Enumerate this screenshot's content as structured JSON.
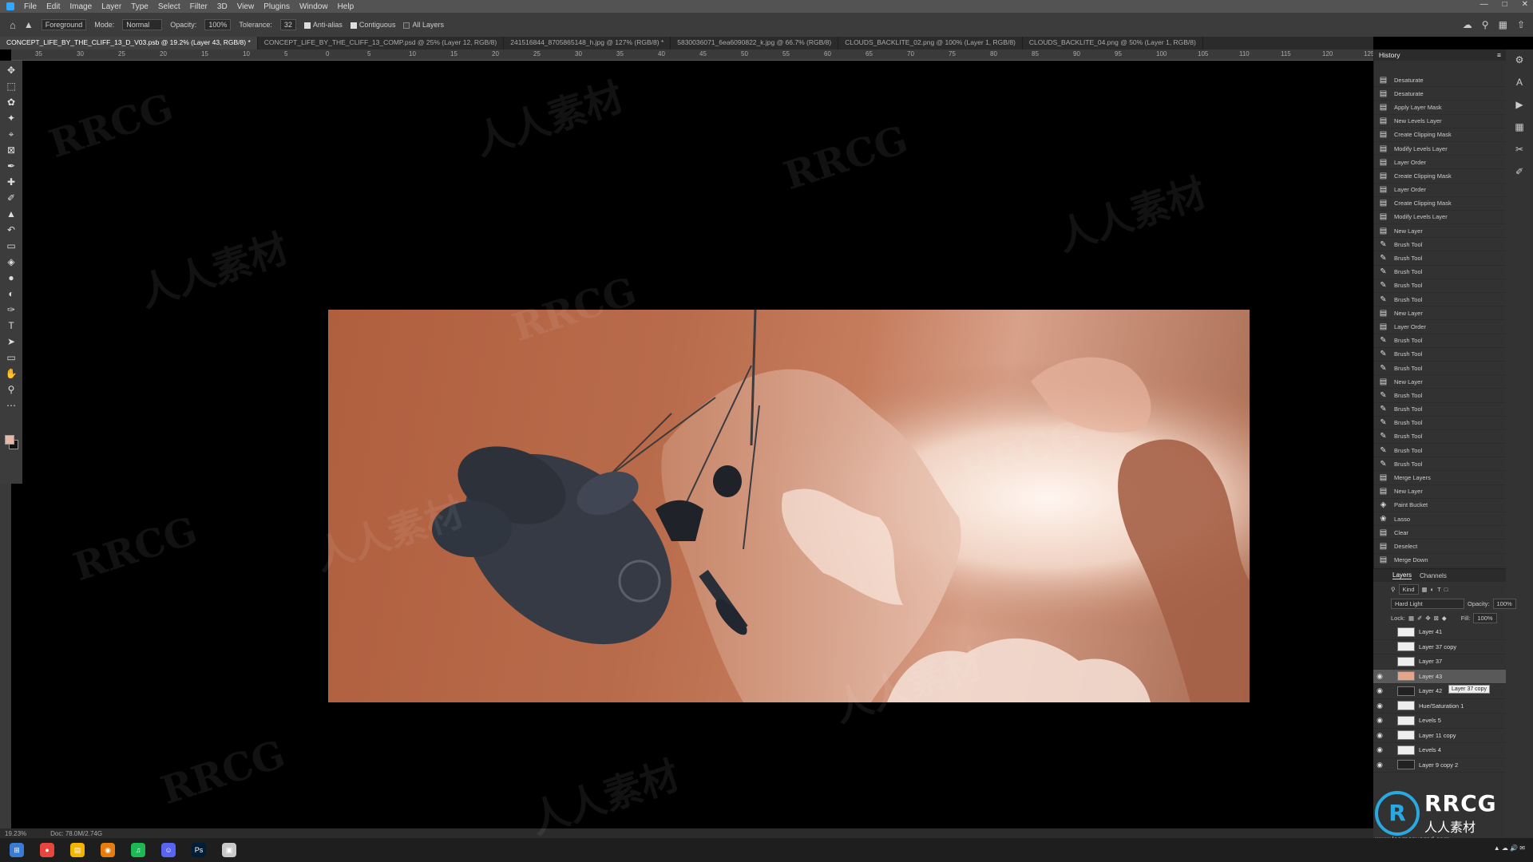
{
  "menubar": {
    "items": [
      "File",
      "Edit",
      "Image",
      "Layer",
      "Type",
      "Select",
      "Filter",
      "3D",
      "View",
      "Plugins",
      "Window",
      "Help"
    ]
  },
  "options": {
    "foreground": "Foreground",
    "mode_label": "Mode:",
    "mode_value": "Normal",
    "opacity_label": "Opacity:",
    "opacity_value": "100%",
    "tolerance_label": "Tolerance:",
    "tolerance_value": "32",
    "anti_alias": "Anti-alias",
    "contiguous": "Contiguous",
    "all_layers": "All Layers"
  },
  "tabs": [
    "CONCEPT_LIFE_BY_THE_CLIFF_13_D_V03.psb @ 19.2% (Layer 43, RGB/8) *",
    "CONCEPT_LIFE_BY_THE_CLIFF_13_COMP.psd @ 25% (Layer 12, RGB/8)",
    "241516844_8705865148_h.jpg @ 127% (RGB/8) *",
    "5830036071_6ea6090822_k.jpg @ 66.7% (RGB/8)",
    "CLOUDS_BACKLITE_02.png @ 100% (Layer 1, RGB/8)",
    "CLOUDS_BACKLITE_04.png @ 50% (Layer 1, RGB/8)"
  ],
  "ruler_ticks": [
    "35",
    "30",
    "25",
    "20",
    "15",
    "10",
    "5",
    "0",
    "5",
    "10",
    "15",
    "20",
    "25",
    "30",
    "35",
    "40",
    "45",
    "50",
    "55",
    "60",
    "65",
    "70",
    "75",
    "80",
    "85",
    "90",
    "95",
    "100",
    "105",
    "110",
    "115",
    "120",
    "125"
  ],
  "status": {
    "zoom": "19.23%",
    "doc": "Doc: 78.0M/2.74G"
  },
  "history": {
    "title": "History",
    "items": [
      "Desaturate",
      "Desaturate",
      "Apply Layer Mask",
      "New Levels Layer",
      "Create Clipping Mask",
      "Modify Levels Layer",
      "Layer Order",
      "Create Clipping Mask",
      "Layer Order",
      "Create Clipping Mask",
      "Modify Levels Layer",
      "New Layer",
      "Brush Tool",
      "Brush Tool",
      "Brush Tool",
      "Brush Tool",
      "Brush Tool",
      "New Layer",
      "Layer Order",
      "Brush Tool",
      "Brush Tool",
      "Brush Tool",
      "New Layer",
      "Brush Tool",
      "Brush Tool",
      "Brush Tool",
      "Brush Tool",
      "Brush Tool",
      "Brush Tool",
      "Merge Layers",
      "New Layer",
      "Paint Bucket",
      "Lasso",
      "Clear",
      "Deselect",
      "Merge Down"
    ],
    "icons": [
      "doc",
      "doc",
      "doc",
      "doc",
      "doc",
      "doc",
      "doc",
      "doc",
      "doc",
      "doc",
      "doc",
      "doc",
      "brush",
      "brush",
      "brush",
      "brush",
      "brush",
      "doc",
      "doc",
      "brush",
      "brush",
      "brush",
      "doc",
      "brush",
      "brush",
      "brush",
      "brush",
      "brush",
      "brush",
      "doc",
      "doc",
      "bucket",
      "lasso",
      "doc",
      "doc",
      "doc"
    ]
  },
  "layers": {
    "tab_layers": "Layers",
    "tab_channels": "Channels",
    "kind": "Kind",
    "blend": "Hard Light",
    "opacity_label": "Opacity:",
    "opacity_value": "100%",
    "lock_label": "Lock:",
    "fill_label": "Fill:",
    "fill_value": "100%",
    "items": [
      {
        "name": "Layer 41",
        "visible": false,
        "thumb": "white"
      },
      {
        "name": "Layer 37 copy",
        "visible": false,
        "thumb": "white"
      },
      {
        "name": "Layer 37",
        "visible": false,
        "thumb": "white"
      },
      {
        "name": "Layer 43",
        "visible": true,
        "thumb": "peach"
      },
      {
        "name": "Layer 42",
        "visible": true,
        "thumb": "dark"
      },
      {
        "name": "Hue/Saturation 1",
        "visible": true,
        "thumb": "white"
      },
      {
        "name": "Levels 5",
        "visible": true,
        "thumb": "white"
      },
      {
        "name": "Layer 11 copy",
        "visible": true,
        "thumb": "white"
      },
      {
        "name": "Levels 4",
        "visible": true,
        "thumb": "white"
      },
      {
        "name": "Layer 9 copy 2",
        "visible": true,
        "thumb": "dark"
      }
    ],
    "tooltip": "Layer 37 copy"
  },
  "watermarks": {
    "latin": "RRCG",
    "cjk": "人人素材"
  },
  "corner_logo": {
    "name": "RRCG",
    "sub": "人人素材",
    "url": "www.learnsquared.com"
  },
  "taskbar": {
    "apps": [
      "win",
      "chrome",
      "files",
      "blender",
      "spotify",
      "discord",
      "ps",
      "box"
    ],
    "colors": {
      "win": "#3a7bd5",
      "chrome": "#e8453c",
      "files": "#f5b400",
      "blender": "#e87d0d",
      "spotify": "#1db954",
      "discord": "#5865f2",
      "ps": "#001e36",
      "box": "#c9c9c9"
    }
  }
}
